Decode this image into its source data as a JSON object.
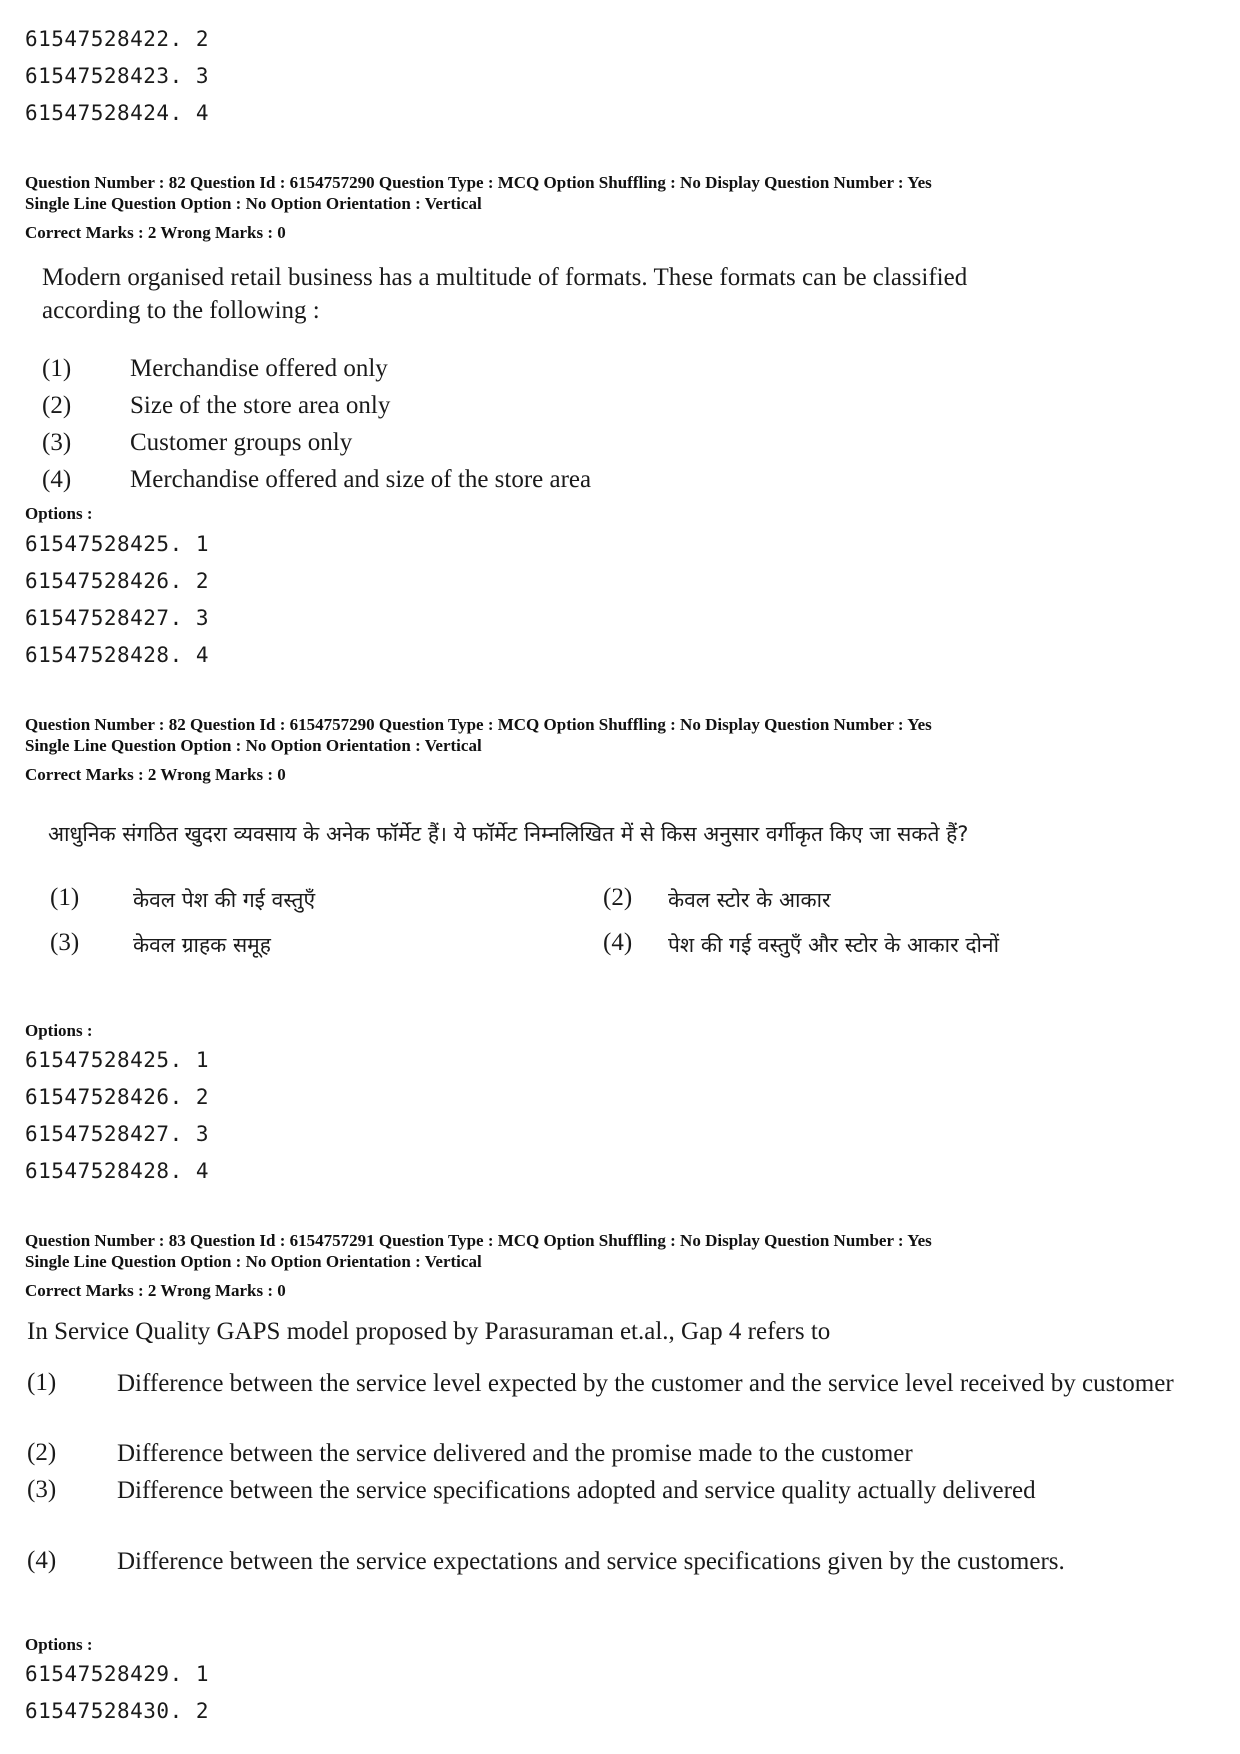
{
  "top_options": [
    {
      "id": "61547528422",
      "num": "2"
    },
    {
      "id": "61547528423",
      "num": "3"
    },
    {
      "id": "61547528424",
      "num": "4"
    }
  ],
  "q82_en": {
    "meta_line1": "Question Number : 82  Question Id : 6154757290  Question Type : MCQ  Option Shuffling : No  Display Question Number : Yes",
    "meta_line2": "Single Line Question Option : No  Option Orientation : Vertical",
    "marks": "Correct Marks : 2  Wrong Marks : 0",
    "question_line1": "Modern organised retail business has a multitude of formats. These formats can be classified",
    "question_line2": "according to the following :",
    "choices": [
      {
        "label": "(1)",
        "text": "Merchandise offered only"
      },
      {
        "label": "(2)",
        "text": "Size of the store area only"
      },
      {
        "label": "(3)",
        "text": "Customer groups only"
      },
      {
        "label": "(4)",
        "text": "Merchandise offered and size of the store area"
      }
    ],
    "options_label": "Options :",
    "options": [
      {
        "id": "61547528425",
        "num": "1"
      },
      {
        "id": "61547528426",
        "num": "2"
      },
      {
        "id": "61547528427",
        "num": "3"
      },
      {
        "id": "61547528428",
        "num": "4"
      }
    ]
  },
  "q82_hi": {
    "meta_line1": "Question Number : 82  Question Id : 6154757290  Question Type : MCQ  Option Shuffling : No  Display Question Number : Yes",
    "meta_line2": "Single Line Question Option : No  Option Orientation : Vertical",
    "marks": "Correct Marks : 2  Wrong Marks : 0",
    "question": "आधुनिक संगठित खुदरा व्यवसाय के अनेक फॉर्मेट हैं। ये फॉर्मेट निम्नलिखित में से किस अनुसार वर्गीकृत किए जा सकते हैं?",
    "choices": [
      {
        "label": "(1)",
        "text": "केवल पेश की गई वस्तुएँ"
      },
      {
        "label": "(2)",
        "text": "केवल स्टोर के आकार"
      },
      {
        "label": "(3)",
        "text": "केवल ग्राहक समूह"
      },
      {
        "label": "(4)",
        "text": "पेश की गई वस्तुएँ और स्टोर के आकार दोनों"
      }
    ],
    "options_label": "Options :",
    "options": [
      {
        "id": "61547528425",
        "num": "1"
      },
      {
        "id": "61547528426",
        "num": "2"
      },
      {
        "id": "61547528427",
        "num": "3"
      },
      {
        "id": "61547528428",
        "num": "4"
      }
    ]
  },
  "q83_en": {
    "meta_line1": "Question Number : 83  Question Id : 6154757291  Question Type : MCQ  Option Shuffling : No  Display Question Number : Yes",
    "meta_line2": "Single Line Question Option : No  Option Orientation : Vertical",
    "marks": "Correct Marks : 2  Wrong Marks : 0",
    "question": "In Service Quality GAPS model proposed by Parasuraman et.al., Gap 4 refers to",
    "choices": [
      {
        "label": "(1)",
        "text": "Difference between the service level expected by the customer and the service level received by customer"
      },
      {
        "label": "(2)",
        "text": "Difference between the service delivered and the promise made to the customer"
      },
      {
        "label": "(3)",
        "text": "Difference between the service specifications adopted and service quality actually delivered"
      },
      {
        "label": "(4)",
        "text": "Difference between the service expectations and service specifications given by the customers."
      }
    ],
    "options_label": "Options :",
    "options": [
      {
        "id": "61547528429",
        "num": "1"
      },
      {
        "id": "61547528430",
        "num": "2"
      }
    ]
  }
}
